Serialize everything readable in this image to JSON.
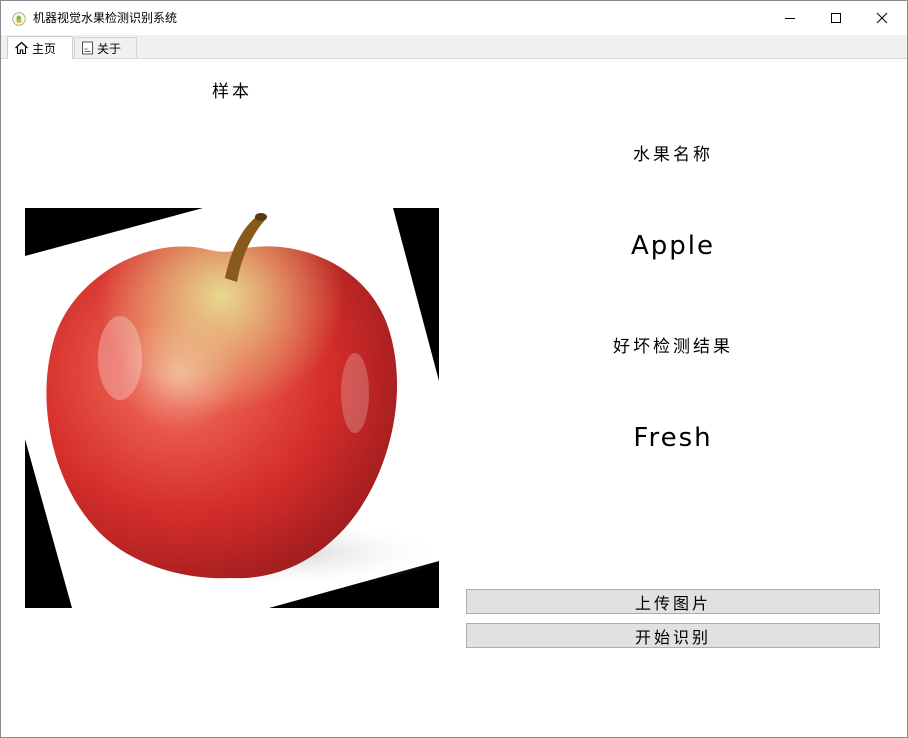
{
  "window": {
    "title": "机器视觉水果检测识别系统"
  },
  "tabs": [
    {
      "label": "主页",
      "icon": "home-icon",
      "active": true
    },
    {
      "label": "关于",
      "icon": "document-icon",
      "active": false
    }
  ],
  "main": {
    "sample_label": "样本",
    "fruit_name_label": "水果名称",
    "fruit_name_value": "Apple",
    "quality_label": "好坏检测结果",
    "quality_value": "Fresh",
    "upload_button": "上传图片",
    "start_button": "开始识别"
  },
  "colors": {
    "apple_red": "#d7302b",
    "apple_highlight": "#f3b9a4",
    "stem": "#8a5a1c",
    "button_bg": "#e1e1e1",
    "tab_bg": "#f0f0f0"
  }
}
